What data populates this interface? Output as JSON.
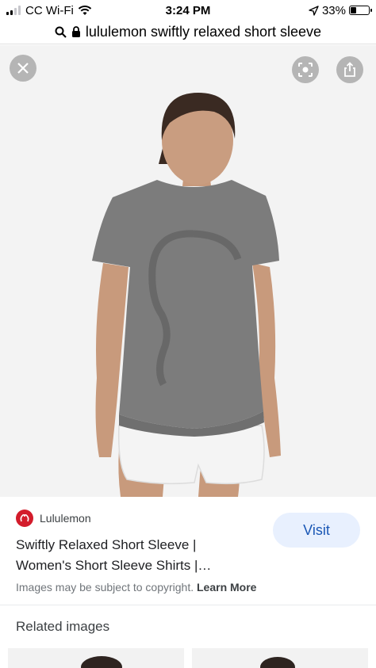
{
  "status_bar": {
    "carrier": "CC Wi-Fi",
    "time": "3:24 PM",
    "battery": "33%",
    "battery_level": 0.33
  },
  "url_bar": {
    "query": "lululemon swiftly relaxed short sleeve"
  },
  "result": {
    "source": "Lululemon",
    "title_line1": "Swiftly Relaxed Short Sleeve |",
    "title_line2": "Women's Short Sleeve Shirts |…",
    "visit_label": "Visit",
    "copyright_text": "Images may be subject to copyright.",
    "learn_more": "Learn More"
  },
  "related": {
    "heading": "Related images"
  },
  "colors": {
    "brand_red": "#d31c2b",
    "visit_bg": "#e8f0fe",
    "visit_text": "#1a57b5"
  }
}
